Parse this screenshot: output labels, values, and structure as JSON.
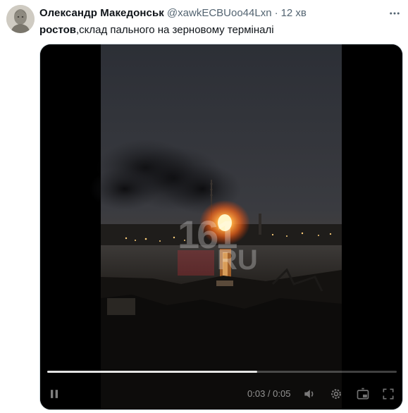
{
  "tweet": {
    "author_name": "Олександр Македонськ",
    "handle": "@xawkECBUoo44Lxn",
    "separator": "·",
    "time": "12 хв",
    "text_bold": "ростов",
    "text_rest": ",склад пального на зерновому терміналі"
  },
  "video": {
    "time_readout": "0:03 / 0:05",
    "progress": 0.6,
    "watermark_digits": "161",
    "watermark_ru": "RU"
  },
  "icons": {
    "more": "more-dots-icon",
    "play": "pause-icon",
    "volume": "volume-icon",
    "settings": "gear-icon",
    "pip": "picture-in-picture-icon",
    "fullscreen": "fullscreen-icon"
  },
  "colors": {
    "text": "#0f1419",
    "secondary_text": "#536471",
    "fire": "#ff7a1a",
    "watermark_red": "#d9303a"
  }
}
